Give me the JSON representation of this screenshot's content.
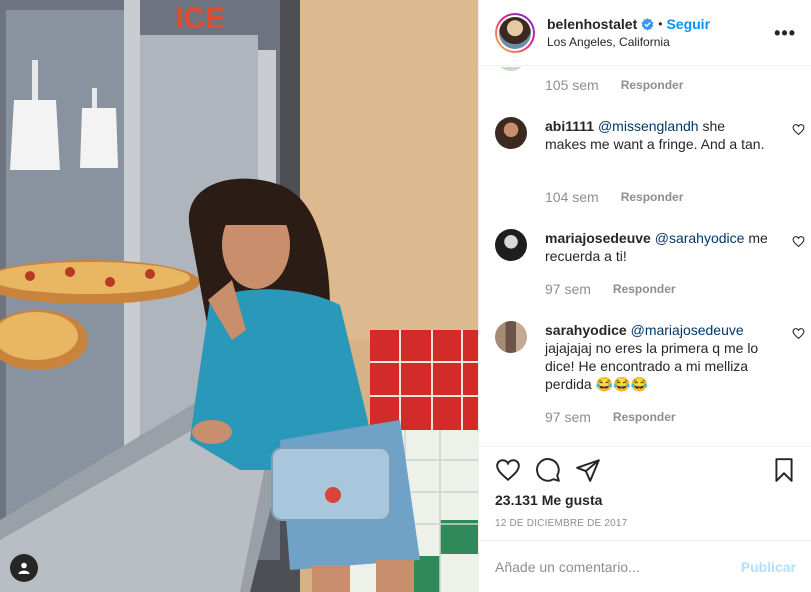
{
  "post": {
    "username": "belenhostalet",
    "verified_icon": "verified-badge-icon",
    "follow_label": "Seguir",
    "separator": "•",
    "location": "Los Angeles, California",
    "more_icon": "more-options-icon",
    "photo_sign_text": "ICE"
  },
  "comments": [
    {
      "username": "",
      "text": "",
      "mention": "",
      "time": "105 sem",
      "reply_label": "Responder"
    },
    {
      "username": "abi1111",
      "mention": "@missenglandh",
      "text": " she makes me want a fringe. And a tan.",
      "time": "104 sem",
      "reply_label": "Responder"
    },
    {
      "username": "mariajosedeuve",
      "mention": "@sarahyodice",
      "text": " me recuerda a ti!",
      "time": "97 sem",
      "reply_label": "Responder"
    },
    {
      "username": "sarahyodice",
      "mention": "@mariajosedeuve",
      "text": " jajajajaj no eres la primera q me lo dice! He encontrado a mi melliza perdida 😂😂😂",
      "time": "97 sem",
      "reply_label": "Responder"
    }
  ],
  "actions": {
    "like_icon": "heart-icon",
    "comment_icon": "comment-icon",
    "share_icon": "share-icon",
    "save_icon": "bookmark-icon",
    "likes_text": "23.131 Me gusta",
    "date_text": "12 DE DICIEMBRE DE 2017"
  },
  "composer": {
    "placeholder": "Añade un comentario...",
    "publish_label": "Publicar"
  },
  "colors": {
    "accent": "#0095f6",
    "publish_disabled": "#b2dffc",
    "muted": "#8e8e8e"
  }
}
